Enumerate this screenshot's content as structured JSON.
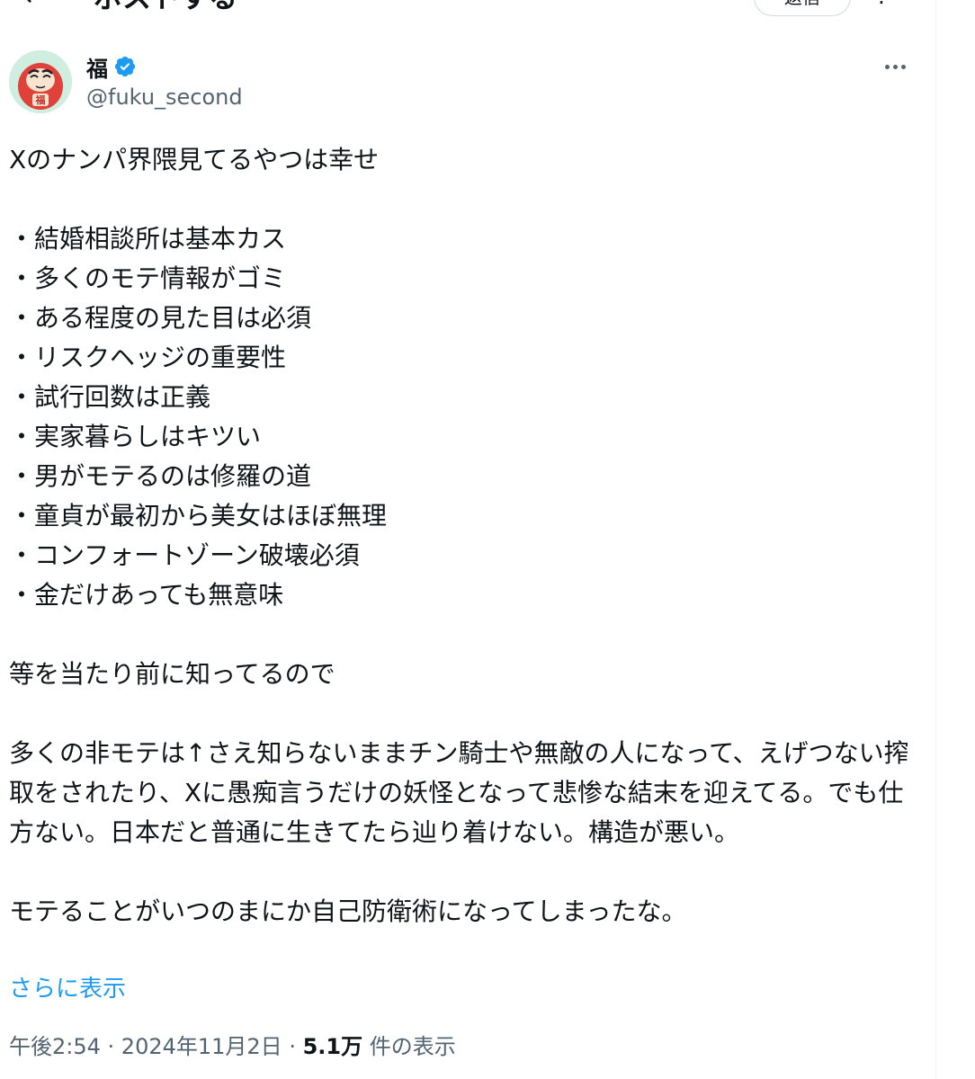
{
  "header": {
    "back_icon": "←",
    "title": "ポストする",
    "reply_button": "返信",
    "more_icon": "⋮"
  },
  "author": {
    "avatar_char": "福",
    "display_name": "福",
    "handle": "@fuku_second",
    "verified": true,
    "verified_color": "#1d9bf0"
  },
  "tweet": {
    "intro": "Xのナンパ界隈見てるやつは幸せ",
    "bullets": [
      "・結婚相談所は基本カス",
      "・多くのモテ情報がゴミ",
      "・ある程度の見た目は必須",
      "・リスクヘッジの重要性",
      "・試行回数は正義",
      "・実家暮らしはキツい",
      "・男がモテるのは修羅の道",
      "・童貞が最初から美女はほぼ無理",
      "・コンフォートゾーン破壊必須",
      "・金だけあっても無意味"
    ],
    "para2": "等を当たり前に知ってるので",
    "para3": "多くの非モテは↑さえ知らないままチン騎士や無敵の人になって、えげつない搾取をされたり、Xに愚痴言うだけの妖怪となって悲惨な結末を迎えてる。でも仕方ない。日本だと普通に生きてたら辿り着けない。構造が悪い。",
    "para4": "モテることがいつのまにか自己防衛術になってしまったな。",
    "show_more": "さらに表示"
  },
  "meta": {
    "time": "午後2:54",
    "separator": " · ",
    "date": "2024年11月2日",
    "views_count": "5.1万",
    "views_label": " 件の表示"
  },
  "colors": {
    "link": "#1d9bf0",
    "secondary_text": "#536471",
    "primary_text": "#0f1419"
  }
}
